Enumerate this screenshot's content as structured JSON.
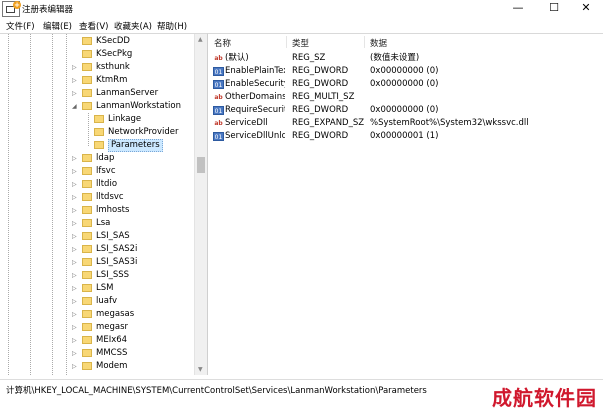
{
  "window": {
    "title": "注册表编辑器",
    "minimize_glyph": "—",
    "maximize_glyph": "☐",
    "close_glyph": "✕"
  },
  "menu": [
    "文件(F)",
    "编辑(E)",
    "查看(V)",
    "收藏夹(A)",
    "帮助(H)"
  ],
  "tree": [
    {
      "label": "KSecDD",
      "expander": ""
    },
    {
      "label": "KSecPkg",
      "expander": ""
    },
    {
      "label": "ksthunk",
      "expander": "▷"
    },
    {
      "label": "KtmRm",
      "expander": "▷"
    },
    {
      "label": "LanmanServer",
      "expander": "▷"
    },
    {
      "label": "LanmanWorkstation",
      "expander": "◢"
    },
    {
      "label": "Linkage",
      "expander": ""
    },
    {
      "label": "NetworkProvider",
      "expander": ""
    },
    {
      "label": "Parameters",
      "expander": ""
    },
    {
      "label": "ldap",
      "expander": "▷"
    },
    {
      "label": "lfsvc",
      "expander": "▷"
    },
    {
      "label": "lltdio",
      "expander": "▷"
    },
    {
      "label": "lltdsvc",
      "expander": "▷"
    },
    {
      "label": "lmhosts",
      "expander": "▷"
    },
    {
      "label": "Lsa",
      "expander": "▷"
    },
    {
      "label": "LSI_SAS",
      "expander": "▷"
    },
    {
      "label": "LSI_SAS2i",
      "expander": "▷"
    },
    {
      "label": "LSI_SAS3i",
      "expander": "▷"
    },
    {
      "label": "LSI_SSS",
      "expander": "▷"
    },
    {
      "label": "LSM",
      "expander": "▷"
    },
    {
      "label": "luafv",
      "expander": "▷"
    },
    {
      "label": "megasas",
      "expander": "▷"
    },
    {
      "label": "megasr",
      "expander": "▷"
    },
    {
      "label": "MEIx64",
      "expander": "▷"
    },
    {
      "label": "MMCSS",
      "expander": "▷"
    },
    {
      "label": "Modem",
      "expander": "▷"
    }
  ],
  "selected_key": "Parameters",
  "columns": {
    "name": "名称",
    "type": "类型",
    "data": "数据"
  },
  "values": [
    {
      "icon": "ab",
      "name": "(默认)",
      "type": "REG_SZ",
      "data": "(数值未设置)"
    },
    {
      "icon": "bin",
      "name": "EnablePlainTex...",
      "type": "REG_DWORD",
      "data": "0x00000000 (0)"
    },
    {
      "icon": "bin",
      "name": "EnableSecurity...",
      "type": "REG_DWORD",
      "data": "0x00000000 (0)"
    },
    {
      "icon": "ab",
      "name": "OtherDomains",
      "type": "REG_MULTI_SZ",
      "data": ""
    },
    {
      "icon": "bin",
      "name": "RequireSecurit...",
      "type": "REG_DWORD",
      "data": "0x00000000 (0)"
    },
    {
      "icon": "ab",
      "name": "ServiceDll",
      "type": "REG_EXPAND_SZ",
      "data": "%SystemRoot%\\System32\\wkssvc.dll"
    },
    {
      "icon": "bin",
      "name": "ServiceDllUnlo...",
      "type": "REG_DWORD",
      "data": "0x00000001 (1)"
    }
  ],
  "status_path": "计算机\\HKEY_LOCAL_MACHINE\\SYSTEM\\CurrentControlSet\\Services\\LanmanWorkstation\\Parameters",
  "watermark": "成航软件园",
  "colors": {
    "selection": "#cce8ff",
    "folder": "#f8d775",
    "watermark": "#d0182d"
  }
}
